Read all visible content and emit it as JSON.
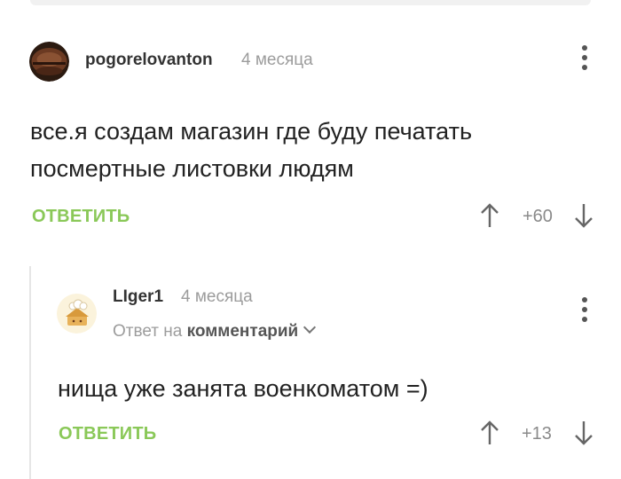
{
  "comments": [
    {
      "username": "pogorelovanton",
      "time": "4 месяца",
      "text": "все.я создам магазин где буду печатать посмертные листовки людям",
      "reply_label": "ОТВЕТИТЬ",
      "rating": "+60"
    },
    {
      "username": "LIger1",
      "time": "4 месяца",
      "reply_to_prefix": "Ответ на",
      "reply_to_target": "комментарий",
      "text": "нища уже занята военкоматом =)",
      "reply_label": "ОТВЕТИТЬ",
      "rating": "+13"
    }
  ],
  "colors": {
    "accent": "#8ac858",
    "muted": "#9c9c9c",
    "text": "#222222"
  },
  "icons": [
    "kebab-menu-icon",
    "upvote-arrow-icon",
    "downvote-arrow-icon",
    "chevron-down-icon"
  ]
}
